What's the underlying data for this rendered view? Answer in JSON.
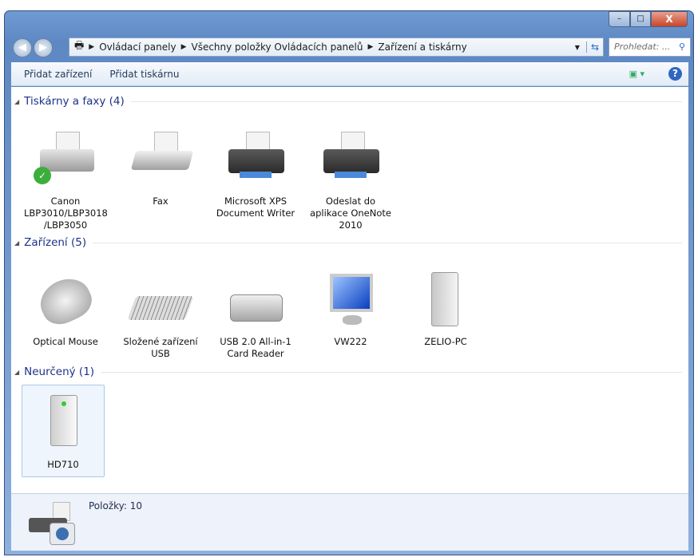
{
  "window": {
    "minimize": "–",
    "maximize": "□",
    "close": "X"
  },
  "address": {
    "crumbs": [
      "Ovládací panely",
      "Všechny položky Ovládacích panelů",
      "Zařízení a tiskárny"
    ],
    "search_placeholder": "Prohledat: ..."
  },
  "toolbar": {
    "add_device": "Přidat zařízení",
    "add_printer": "Přidat tiskárnu"
  },
  "groups": [
    {
      "title": "Tiskárny a faxy (4)",
      "items": [
        "Canon LBP3010/LBP3018 /LBP3050",
        "Fax",
        "Microsoft XPS Document Writer",
        "Odeslat do aplikace OneNote 2010"
      ]
    },
    {
      "title": "Zařízení (5)",
      "items": [
        "Optical Mouse",
        "Složené zařízení USB",
        "USB 2.0 All-in-1 Card Reader",
        "VW222",
        "ZELIO-PC"
      ]
    },
    {
      "title": "Neurčený (1)",
      "items": [
        "HD710"
      ]
    }
  ],
  "status": {
    "count": "Položky: 10"
  }
}
